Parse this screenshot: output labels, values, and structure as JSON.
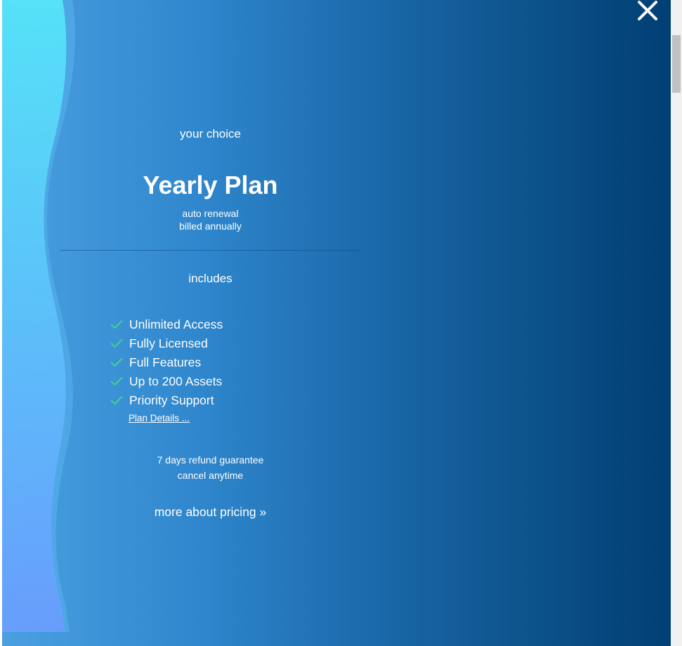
{
  "window": {
    "close_icon": "close-icon"
  },
  "plan": {
    "eyebrow": "your choice",
    "title": "Yearly Plan",
    "renewal": "auto renewal",
    "billing": "billed annually"
  },
  "includes": {
    "heading": "includes",
    "check_color": "#3fd28a",
    "items": [
      {
        "label": "Unlimited Access",
        "icon": "check-icon"
      },
      {
        "label": "Fully Licensed",
        "icon": "check-icon"
      },
      {
        "label": "Full Features",
        "icon": "check-icon"
      },
      {
        "label": "Up to 200 Assets",
        "icon": "check-icon"
      },
      {
        "label": "Priority Support",
        "icon": "check-icon"
      }
    ],
    "details_link": "Plan Details ..."
  },
  "guarantee": {
    "refund": "7 days refund guarantee",
    "cancel": "cancel anytime"
  },
  "pricing_link": "more about pricing »",
  "colors": {
    "gradient_start": "#4aa0e0",
    "gradient_end": "#003f73",
    "wave_light": "#54e6f8",
    "wave_violet": "#6aa0ff"
  }
}
